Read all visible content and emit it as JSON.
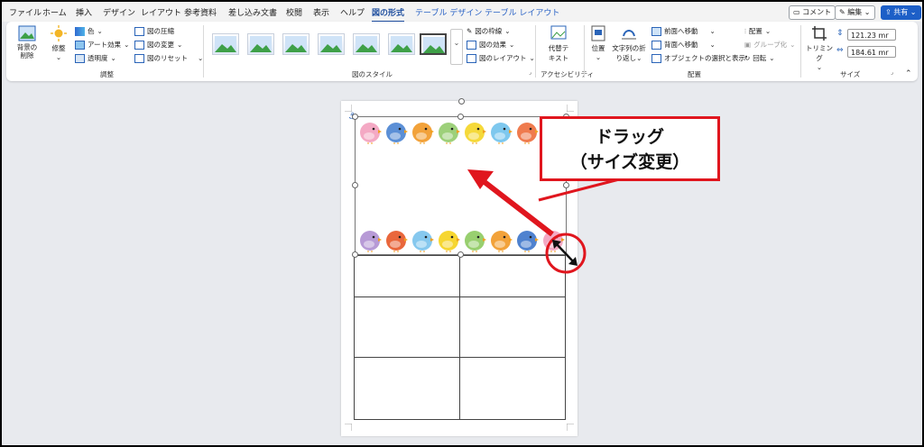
{
  "tabs": [
    "ファイル",
    "ホーム",
    "挿入",
    "デザイン",
    "レイアウト",
    "参考資料",
    "差し込み文書",
    "校閲",
    "表示",
    "ヘルプ",
    "図の形式",
    "テーブル デザイン",
    "テーブル レイアウト"
  ],
  "active_tab": "図の形式",
  "titlebar_buttons": {
    "comment": "コメント",
    "edit": "編集",
    "share": "共有"
  },
  "ribbon": {
    "adjust": {
      "remove_bg": "背景の削除",
      "corrections": "修整",
      "color": "色",
      "art_effects": "アート効果",
      "transparency": "透明度",
      "compress": "図の圧縮",
      "change": "図の変更",
      "reset": "図のリセット",
      "group_label": "調整"
    },
    "styles": {
      "border": "図の枠線",
      "effects": "図の効果",
      "layout": "図のレイアウト",
      "group_label": "図のスタイル"
    },
    "accessibility": {
      "alt_text_1": "代替テ",
      "alt_text_2": "キスト",
      "group_label": "アクセシビリティ"
    },
    "arrange": {
      "position": "位置",
      "wrap_1": "文字列の折",
      "wrap_2": "り返し",
      "bring_forward": "前面へ移動",
      "send_backward": "背面へ移動",
      "selection_pane": "オブジェクトの選択と表示",
      "align": "配置",
      "group": "グループ化",
      "rotate": "回転",
      "group_label": "配置"
    },
    "size": {
      "crop": "トリミング",
      "height": "121.23 mr",
      "width": "184.61 mr",
      "group_label": "サイズ"
    }
  },
  "callout": {
    "line1": "ドラッグ",
    "line2": "（サイズ変更）"
  },
  "colors": {
    "accent": "#1e4e9e",
    "callout": "#e0161e",
    "share": "#1d5fc7"
  },
  "birds_top": [
    "#f4a9c4",
    "#5b8fd6",
    "#f2a23a",
    "#9dd07a",
    "#f5d93a",
    "#7ec8ee",
    "#ef7b4e",
    "#c7a0d8"
  ],
  "birds_bottom": [
    "#b79ad6",
    "#e9673c",
    "#86c8ee",
    "#f6d631",
    "#98cf6f",
    "#f2a23a",
    "#4f82cf",
    "#f4a9c4"
  ]
}
